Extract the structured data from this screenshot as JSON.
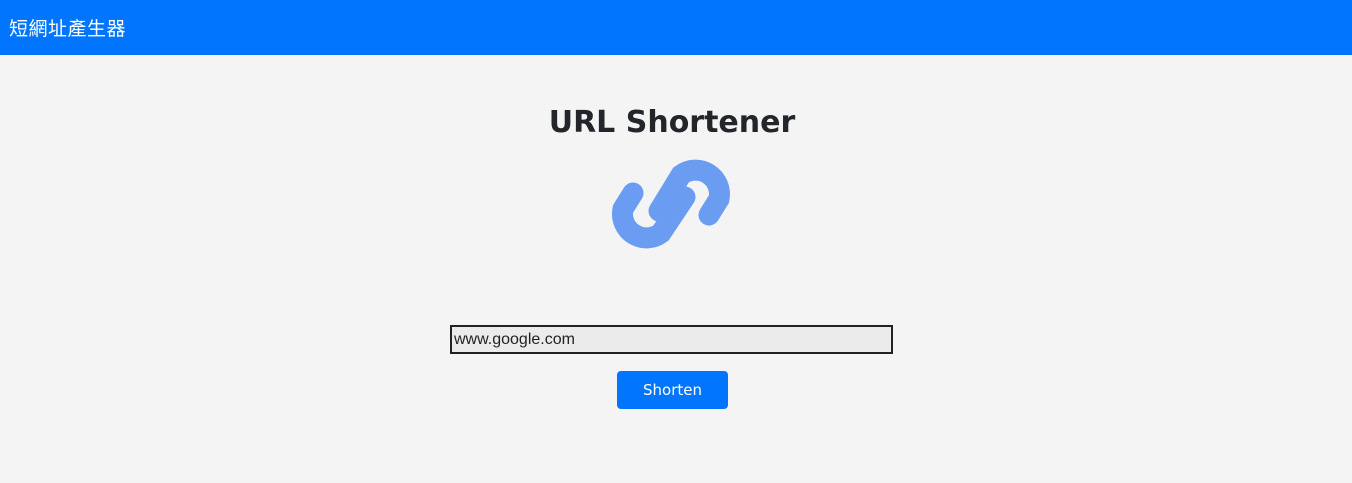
{
  "navbar": {
    "brand": "短網址產生器",
    "color": "#0275ff"
  },
  "main": {
    "title": "URL Shortener",
    "logo_icon": "link-icon",
    "logo_color": "#6a9cf2",
    "url_input": {
      "value": "www.google.com",
      "placeholder": ""
    },
    "shorten_button": {
      "label": "Shorten",
      "color": "#0275ff"
    }
  }
}
